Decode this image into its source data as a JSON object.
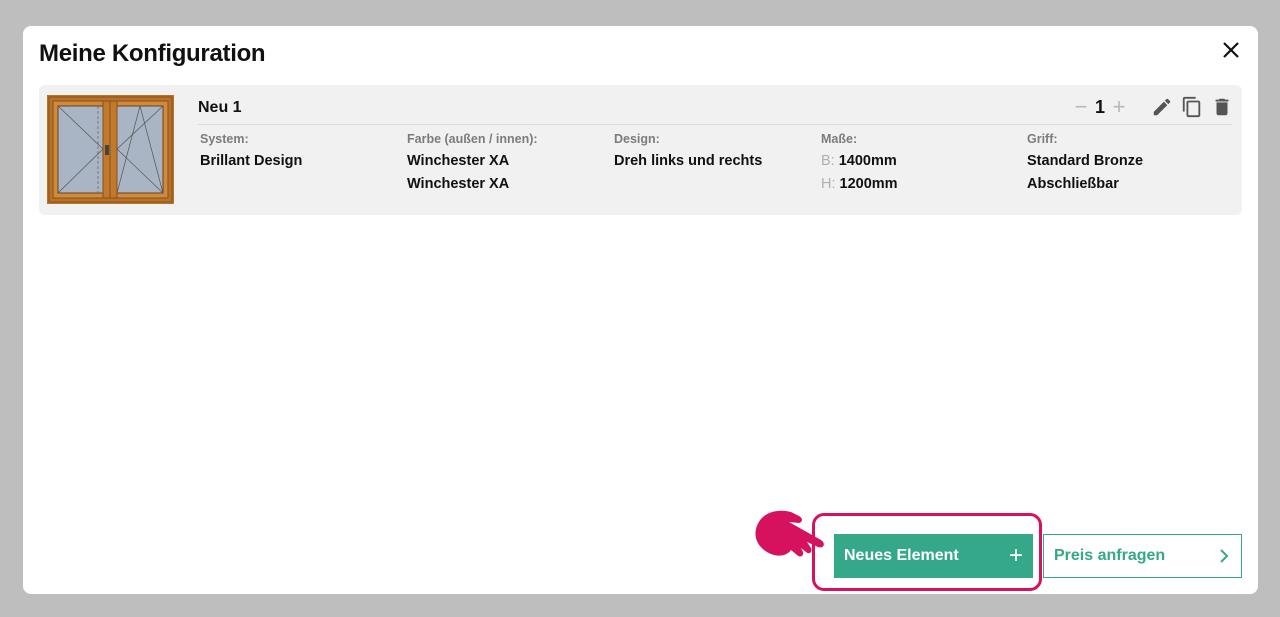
{
  "modal": {
    "title": "Meine Konfiguration",
    "close_icon": "close-icon"
  },
  "item": {
    "name": "Neu 1",
    "quantity": "1",
    "qty_minus": "−",
    "qty_plus": "+",
    "icons": [
      "edit-icon",
      "copy-icon",
      "delete-icon"
    ],
    "system_label": "System:",
    "system_value": "Brillant Design",
    "color_label": "Farbe (außen / innen):",
    "color_outer": "Winchester XA",
    "color_inner": "Winchester XA",
    "design_label": "Design:",
    "design_value": "Dreh links und rechts",
    "size_label": "Maße:",
    "width_prefix": "B:",
    "width_value": "1400mm",
    "height_prefix": "H:",
    "height_value": "1200mm",
    "handle_label": "Griff:",
    "handle_value": "Standard Bronze",
    "handle_option": "Abschließbar"
  },
  "actions": {
    "new_element_label": "Neues Element",
    "new_element_icon": "+",
    "request_price_label": "Preis anfragen",
    "request_price_icon": "›"
  },
  "colors": {
    "accent": "#36a88a",
    "highlight": "#d6125f",
    "frame_wood": "#c17a2c"
  }
}
